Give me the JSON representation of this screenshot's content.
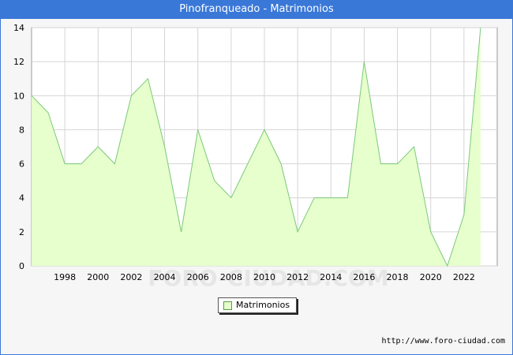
{
  "header": {
    "title": "Pinofranqueado - Matrimonios"
  },
  "chart_data": {
    "type": "area",
    "title": "Pinofranqueado - Matrimonios",
    "x": [
      1996,
      1997,
      1998,
      1999,
      2000,
      2001,
      2002,
      2003,
      2004,
      2005,
      2006,
      2007,
      2008,
      2009,
      2010,
      2011,
      2012,
      2013,
      2014,
      2015,
      2016,
      2017,
      2018,
      2019,
      2020,
      2021,
      2022,
      2023
    ],
    "series": [
      {
        "name": "Matrimonios",
        "values": [
          10,
          9,
          6,
          6,
          7,
          6,
          10,
          11,
          7,
          2,
          8,
          5,
          4,
          6,
          8,
          6,
          2,
          4,
          4,
          4,
          12,
          6,
          6,
          7,
          2,
          0,
          3,
          14
        ]
      }
    ],
    "xticks": [
      "1998",
      "2000",
      "2002",
      "2004",
      "2006",
      "2008",
      "2010",
      "2012",
      "2014",
      "2016",
      "2018",
      "2020",
      "2022"
    ],
    "yticks": [
      "0",
      "2",
      "4",
      "6",
      "8",
      "10",
      "12",
      "14"
    ],
    "xlim": [
      1996,
      2024
    ],
    "ylim": [
      0,
      14
    ],
    "grid": true,
    "legend_position": "bottom-center",
    "colors": {
      "fill": "#e6ffcc",
      "line": "#7cc87c",
      "header": "#3a78d8"
    }
  },
  "legend": {
    "label": "Matrimonios"
  },
  "watermark": "FORO-CIUDAD.COM",
  "source": "http://www.foro-ciudad.com"
}
